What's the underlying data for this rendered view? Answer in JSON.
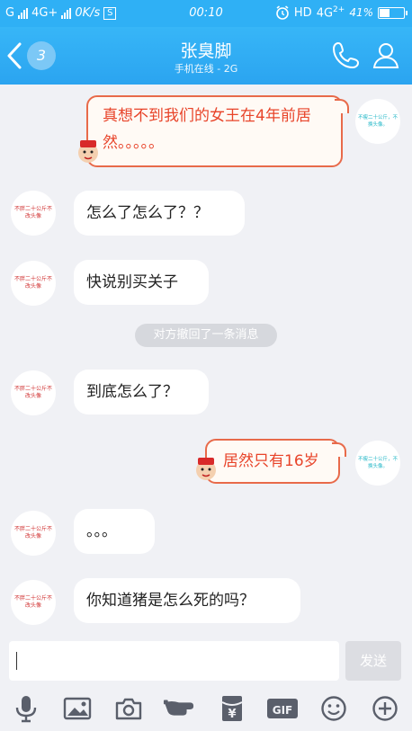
{
  "status_bar": {
    "carrier": "G",
    "network": "4G+",
    "speed": "0K/s",
    "s_badge": "S",
    "time": "00:10",
    "hd": "HD",
    "network_right": "4G",
    "network_right_sup": "2+",
    "battery_percent": "41%",
    "battery_level": 0.41
  },
  "header": {
    "unread_count": "3",
    "title": "张臭脚",
    "subtitle": "手机在线 - 2G"
  },
  "avatars": {
    "peer_text": "不胖二十公斤不改头像",
    "self_text": "不瘦二十公斤，不换头像。"
  },
  "messages": [
    {
      "side": "self",
      "text": "真想不到我们的女王在4年前居然。。。。。"
    },
    {
      "side": "peer",
      "text": "怎么了怎么了？？"
    },
    {
      "side": "peer",
      "text": "快说别买关子"
    },
    {
      "side": "system",
      "text": "对方撤回了一条消息"
    },
    {
      "side": "peer",
      "text": "到底怎么了？"
    },
    {
      "side": "self",
      "text": "居然只有16岁"
    },
    {
      "side": "peer",
      "text": "。。。"
    },
    {
      "side": "peer",
      "text": "你知道猪是怎么死的吗？"
    }
  ],
  "input": {
    "value": "",
    "send_label": "发送"
  },
  "toolbar": {
    "gif_label": "GIF",
    "red_packet_glyph": "¥",
    "icons": [
      "microphone-icon",
      "image-icon",
      "camera-icon",
      "poke-hand-icon",
      "red-packet-icon",
      "gif-icon",
      "emoji-icon",
      "plus-icon"
    ]
  },
  "colors": {
    "header_blue": "#2fb0f5",
    "custom_bubble_border": "#e86a4a",
    "custom_bubble_text": "#e8442a"
  }
}
